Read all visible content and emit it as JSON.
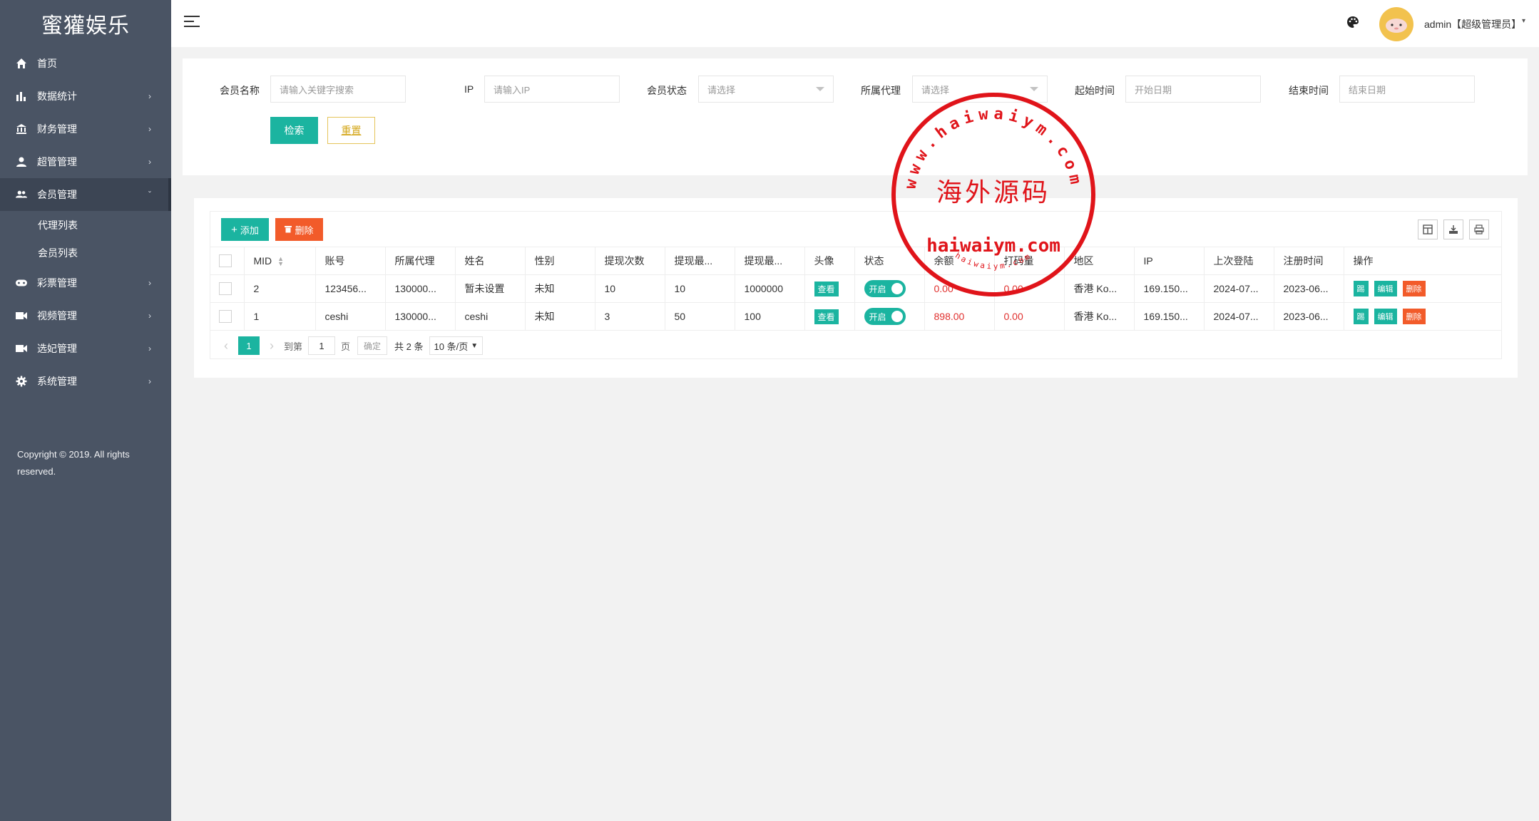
{
  "app": {
    "title": "蜜獾娱乐"
  },
  "sidebar": {
    "items": [
      {
        "label": "首页",
        "icon": "home-icon",
        "chevron": ""
      },
      {
        "label": "数据统计",
        "icon": "bar-chart-icon",
        "chevron": "›"
      },
      {
        "label": "财务管理",
        "icon": "bank-icon",
        "chevron": "›"
      },
      {
        "label": "超管管理",
        "icon": "user-icon",
        "chevron": "›"
      },
      {
        "label": "会员管理",
        "icon": "users-icon",
        "chevron": "ˇ"
      },
      {
        "label": "彩票管理",
        "icon": "gamepad-icon",
        "chevron": "›"
      },
      {
        "label": "视频管理",
        "icon": "video-icon",
        "chevron": "›"
      },
      {
        "label": "选妃管理",
        "icon": "video-icon",
        "chevron": "›"
      },
      {
        "label": "系统管理",
        "icon": "gear-icon",
        "chevron": "›"
      }
    ],
    "sub_items": [
      "代理列表",
      "会员列表"
    ],
    "copyright": "Copyright © 2019. All rights reserved."
  },
  "header": {
    "user": "admin【超级管理员】",
    "caret": "▾"
  },
  "search": {
    "fields": [
      {
        "label": "会员名称",
        "placeholder": "请输入关键字搜索",
        "type": "text"
      },
      {
        "label": "IP",
        "placeholder": "请输入IP",
        "type": "text"
      },
      {
        "label": "会员状态",
        "placeholder": "请选择",
        "type": "select"
      },
      {
        "label": "所属代理",
        "placeholder": "请选择",
        "type": "select"
      },
      {
        "label": "起始时间",
        "placeholder": "开始日期",
        "type": "date"
      },
      {
        "label": "结束时间",
        "placeholder": "结束日期",
        "type": "date"
      }
    ],
    "search_label": "检索",
    "reset_label": "重置"
  },
  "toolbar": {
    "add_label": "添加",
    "delete_label": "删除"
  },
  "table": {
    "columns": [
      "MID",
      "账号",
      "所属代理",
      "姓名",
      "性别",
      "提现次数",
      "提现最...",
      "提现最...",
      "头像",
      "状态",
      "余额",
      "打码量",
      "地区",
      "IP",
      "上次登陆",
      "注册时间",
      "操作"
    ],
    "rows": [
      {
        "mid": "2",
        "account": "123456...",
        "agent": "130000...",
        "name": "暂未设置",
        "gender": "未知",
        "withdraw_count": "10",
        "withdraw_min": "10",
        "withdraw_max": "1000000",
        "avatar": "查看",
        "status": "开启",
        "balance": "0.00",
        "bet": "0.00",
        "region": "香港 Ko...",
        "ip": "169.150...",
        "last_login": "2024-07...",
        "registered": "2023-06...",
        "ops": [
          "踢",
          "编辑",
          "删除"
        ]
      },
      {
        "mid": "1",
        "account": "ceshi",
        "agent": "130000...",
        "name": "ceshi",
        "gender": "未知",
        "withdraw_count": "3",
        "withdraw_min": "50",
        "withdraw_max": "100",
        "avatar": "查看",
        "status": "开启",
        "balance": "898.00",
        "bet": "0.00",
        "region": "香港 Ko...",
        "ip": "169.150...",
        "last_login": "2024-07...",
        "registered": "2023-06...",
        "ops": [
          "踢",
          "编辑",
          "删除"
        ]
      }
    ]
  },
  "pager": {
    "prev": "‹",
    "current": "1",
    "next": "›",
    "goto_label": "到第",
    "goto_value": "1",
    "page_unit": "页",
    "confirm": "确定",
    "total": "共 2 条",
    "page_size": "10 条/页"
  },
  "watermark": {
    "top_text": "www.haiwaiym.com",
    "center_text": "海外源码",
    "bottom_text": "haiwaiym.com",
    "small_text": "haiwaiym.com",
    "color": "#e0141a"
  },
  "colors": {
    "sidebar": "#4a5464",
    "accent": "#1bb4a0",
    "danger": "#f25b2a"
  }
}
